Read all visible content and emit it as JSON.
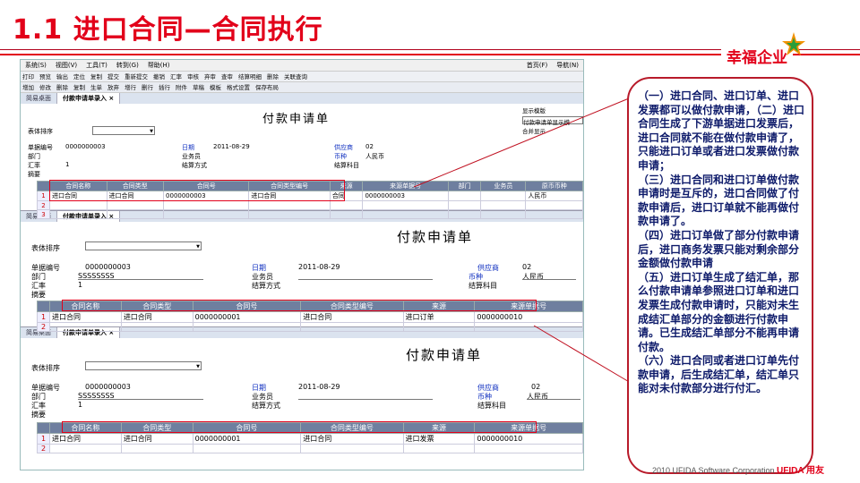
{
  "slide": {
    "title": "1.1  进口合同—合同执行",
    "brand": "幸福企业",
    "footer_text": "2010 UFIDA Software Corporation",
    "footer_logo": "UFIDA 用友",
    "accent": "#e2001a"
  },
  "app": {
    "menu": [
      "系统(S)",
      "视图(V)",
      "工具(T)",
      "转到(G)",
      "帮助(H)"
    ],
    "menu_right": [
      "首页(F)",
      "导航(N)"
    ],
    "toolbar1": [
      "打印",
      "预览",
      "输出",
      "定位",
      "复制",
      "提交",
      "重新提交",
      "撤销",
      "汇率",
      "审核",
      "弃审",
      "查审",
      "结算明细",
      "删除",
      "关联查询"
    ],
    "toolbar2": [
      "增加",
      "修改",
      "删除",
      "复制",
      "生单",
      "放弃",
      "增行",
      "删行",
      "插行",
      "附件",
      "草稿",
      "模板",
      "格式设置",
      "保存布局"
    ],
    "tabs": [
      "简易桌面",
      "付款申请单录入 ×"
    ],
    "side_labels": [
      "显示模版",
      "付款申请单显示模",
      "合并显示"
    ]
  },
  "form": {
    "title": "付款申请单",
    "sort_label": "表体排序",
    "fields": {
      "doc_no_label": "单据编号",
      "doc_no": "0000000003",
      "date_label": "日期",
      "date": "2011-08-29",
      "supplier_label": "供应商",
      "supplier": "02",
      "dept_label": "部门",
      "dept": "SSSSSSSS",
      "staff_label": "业务员",
      "currency_label": "币种",
      "currency": "人民币",
      "rate_label": "汇率",
      "rate": "1",
      "settle_label": "结算方式",
      "subject_label": "结算科目",
      "memo_label": "摘要"
    }
  },
  "grid": {
    "headers": [
      "合同名称",
      "合同类型",
      "合同号",
      "合同类型编号",
      "来源",
      "来源单据号",
      "部门",
      "业务员",
      "原币币种"
    ],
    "row1": [
      "进口合同",
      "进口合同",
      "0000000003",
      "进口合同",
      "合同",
      "0000000003",
      "",
      "",
      "人民币"
    ],
    "row2": [
      "进口合同",
      "进口合同",
      "0000000001",
      "进口合同",
      "进口订单",
      "0000000010"
    ],
    "row3": [
      "进口合同",
      "进口合同",
      "0000000001",
      "进口合同",
      "进口发票",
      "0000000010"
    ],
    "row_numbers": [
      "1",
      "2",
      "3"
    ]
  },
  "callout": [
    "（一）进口合同、进口订单、进口发票都可以做付款申请，（二）进口合同生成了下游单据进口发票后，进口合同就不能在做付款申请了，只能进口订单或者进口发票做付款申请；",
    "（三）进口合同和进口订单做付款申请时是互斥的，进口合同做了付款申请后，进口订单就不能再做付款申请了。",
    "（四）进口订单做了部分付款申请后，进口商务发票只能对剩余部分金额做付款申请",
    "（五）进口订单生成了结汇单，那么付款申请单参照进口订单和进口发票生成付款申请时，只能对未生成结汇单部分的金额进行付款申请。已生成结汇单部分不能再申请付款。",
    "（六）进口合同或者进口订单先付款申请，后生成结汇单，结汇单只能对未付款部分进行付汇。"
  ]
}
